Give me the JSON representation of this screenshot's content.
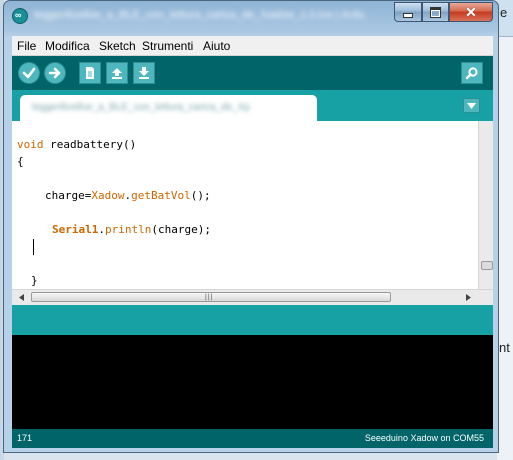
{
  "window": {
    "title": "leggerilivelloe_a_BLE_con_lettura_carica_de_Xadow_1.0.ino | Arduino 1.0.5",
    "active_tab": "leggerilivelloe_a_BLE_con_lettura_carica_de_Xp"
  },
  "menu": {
    "file": "File",
    "edit": "Modifica",
    "sketch": "Sketch",
    "tools": "Strumenti",
    "help": "Aiuto"
  },
  "code": {
    "line1_keyword": "void",
    "line1_rest": " readbattery()",
    "line2": "{",
    "line3_prefix": "charge=",
    "line3_object": "Xadow",
    "line3_dot": ".",
    "line3_method": "getBatVol",
    "line3_suffix": "();",
    "line4_object": "Serial1",
    "line4_dot": ".",
    "line4_method": "println",
    "line4_suffix": "(charge);",
    "line5": "}"
  },
  "status": {
    "line_number": "171",
    "board_port": "Seeeduino Xadow on COM55"
  },
  "background": {
    "right_edge_glyph": "e",
    "right_edge_glyph2": "nt"
  },
  "colors": {
    "teal_dark": "#006468",
    "teal_light": "#17a1a5",
    "keyword_orange": "#cc6600"
  }
}
